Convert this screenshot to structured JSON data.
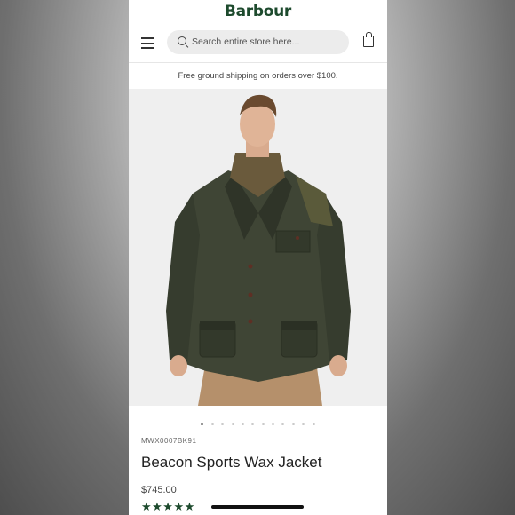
{
  "brand": {
    "name": "Barbour",
    "color": "#1d4a2d"
  },
  "search": {
    "placeholder": "Search entire store here..."
  },
  "banner": {
    "text": "Free ground shipping on orders over $100."
  },
  "carousel": {
    "count": 12,
    "active_index": 0
  },
  "product": {
    "sku": "MWX0007BK91",
    "name": "Beacon Sports Wax Jacket",
    "price": "$745.00",
    "rating": 5,
    "stars": "★★★★★"
  }
}
